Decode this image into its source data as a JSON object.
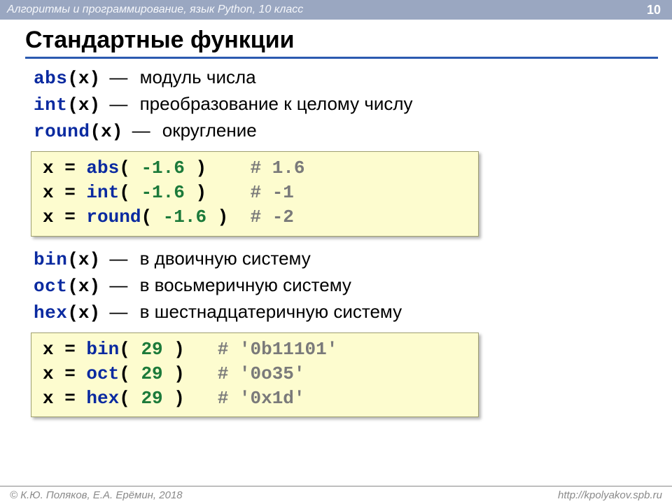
{
  "header": {
    "breadcrumb": "Алгоритмы и программирование, язык Python, 10 класс",
    "page_num": "10"
  },
  "title": "Стандартные функции",
  "defs1": [
    {
      "fn": "abs",
      "arg": "(x)",
      "dash": "—",
      "desc": "модуль числа"
    },
    {
      "fn": "int",
      "arg": "(x)",
      "dash": "—",
      "desc": "преобразование к целому числу"
    },
    {
      "fn": "round",
      "arg": "(x)",
      "dash": "—",
      "desc": "округление"
    }
  ],
  "code1": [
    {
      "lhs": "x = ",
      "fn": "abs",
      "open": "( ",
      "val": "-1.6",
      "close": " )    ",
      "cmt": "# 1.6"
    },
    {
      "lhs": "x = ",
      "fn": "int",
      "open": "( ",
      "val": "-1.6",
      "close": " )    ",
      "cmt": "# -1"
    },
    {
      "lhs": "x = ",
      "fn": "round",
      "open": "( ",
      "val": "-1.6",
      "close": " )  ",
      "cmt": "# -2"
    }
  ],
  "defs2": [
    {
      "fn": "bin",
      "arg": "(x)",
      "dash": "—",
      "desc": "в двоичную систему"
    },
    {
      "fn": "oct",
      "arg": "(x)",
      "dash": "—",
      "desc": "в восьмеричную систему"
    },
    {
      "fn": "hex",
      "arg": "(x)",
      "dash": "—",
      "desc": "в шестнадцатеричную систему"
    }
  ],
  "code2": [
    {
      "lhs": "x = ",
      "fn": "bin",
      "open": "( ",
      "val": "29",
      "close": " )   ",
      "cmt": "# '0b11101'"
    },
    {
      "lhs": "x = ",
      "fn": "oct",
      "open": "( ",
      "val": "29",
      "close": " )   ",
      "cmt": "# '0o35'"
    },
    {
      "lhs": "x = ",
      "fn": "hex",
      "open": "( ",
      "val": "29",
      "close": " )   ",
      "cmt": "# '0x1d'"
    }
  ],
  "footer": {
    "left": "© К.Ю. Поляков, Е.А. Ерёмин, 2018",
    "right": "http://kpolyakov.spb.ru"
  }
}
